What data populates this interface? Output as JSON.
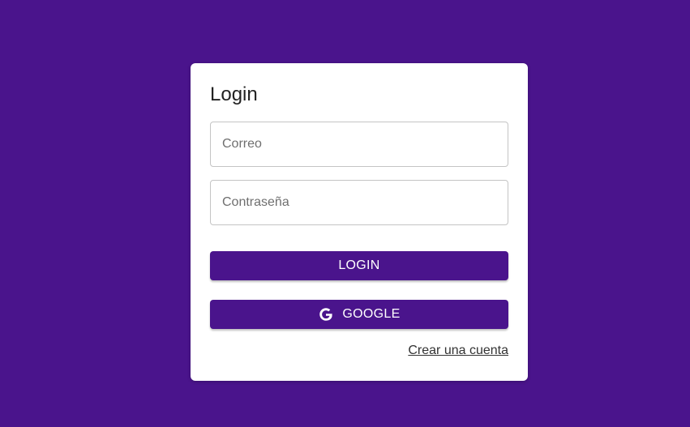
{
  "login_card": {
    "title": "Login",
    "email": {
      "placeholder": "Correo",
      "value": ""
    },
    "password": {
      "placeholder": "Contraseña",
      "value": ""
    },
    "login_button": {
      "label": "LOGIN"
    },
    "google_button": {
      "label": "GOOGLE",
      "icon": "google-icon"
    },
    "create_account_link": {
      "label": "Crear una cuenta"
    }
  },
  "colors": {
    "background": "#4a148c",
    "card": "#ffffff",
    "button": "#4a148c",
    "button_text": "#ffffff"
  }
}
